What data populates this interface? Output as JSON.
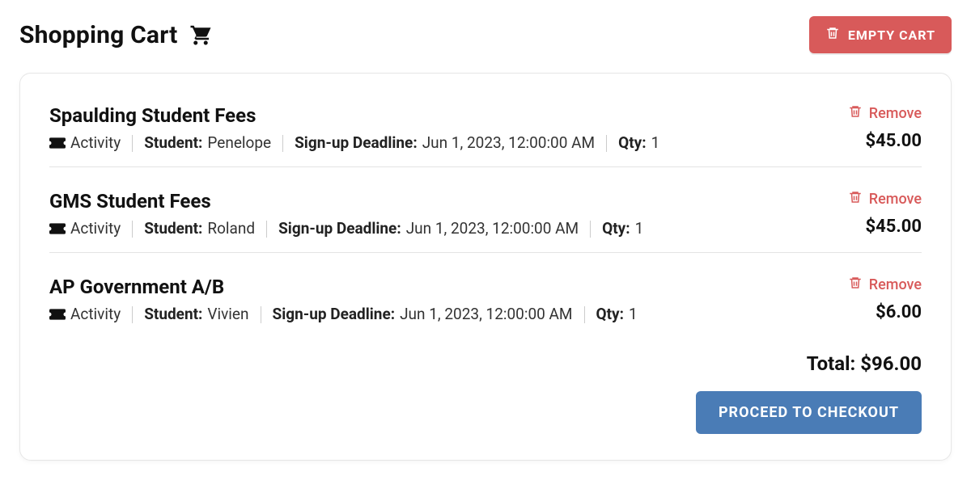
{
  "header": {
    "title": "Shopping Cart",
    "empty_button": "EMPTY CART"
  },
  "labels": {
    "activity": "Activity",
    "student": "Student:",
    "deadline": "Sign-up Deadline:",
    "qty": "Qty:",
    "remove": "Remove",
    "total_prefix": "Total:",
    "checkout": "PROCEED TO CHECKOUT"
  },
  "items": [
    {
      "name": "Spaulding Student Fees",
      "student": "Penelope",
      "deadline": "Jun 1, 2023, 12:00:00 AM",
      "qty": "1",
      "price": "$45.00"
    },
    {
      "name": "GMS Student Fees",
      "student": "Roland",
      "deadline": "Jun 1, 2023, 12:00:00 AM",
      "qty": "1",
      "price": "$45.00"
    },
    {
      "name": "AP Government A/B",
      "student": "Vivien",
      "deadline": "Jun 1, 2023, 12:00:00 AM",
      "qty": "1",
      "price": "$6.00"
    }
  ],
  "total": "$96.00"
}
